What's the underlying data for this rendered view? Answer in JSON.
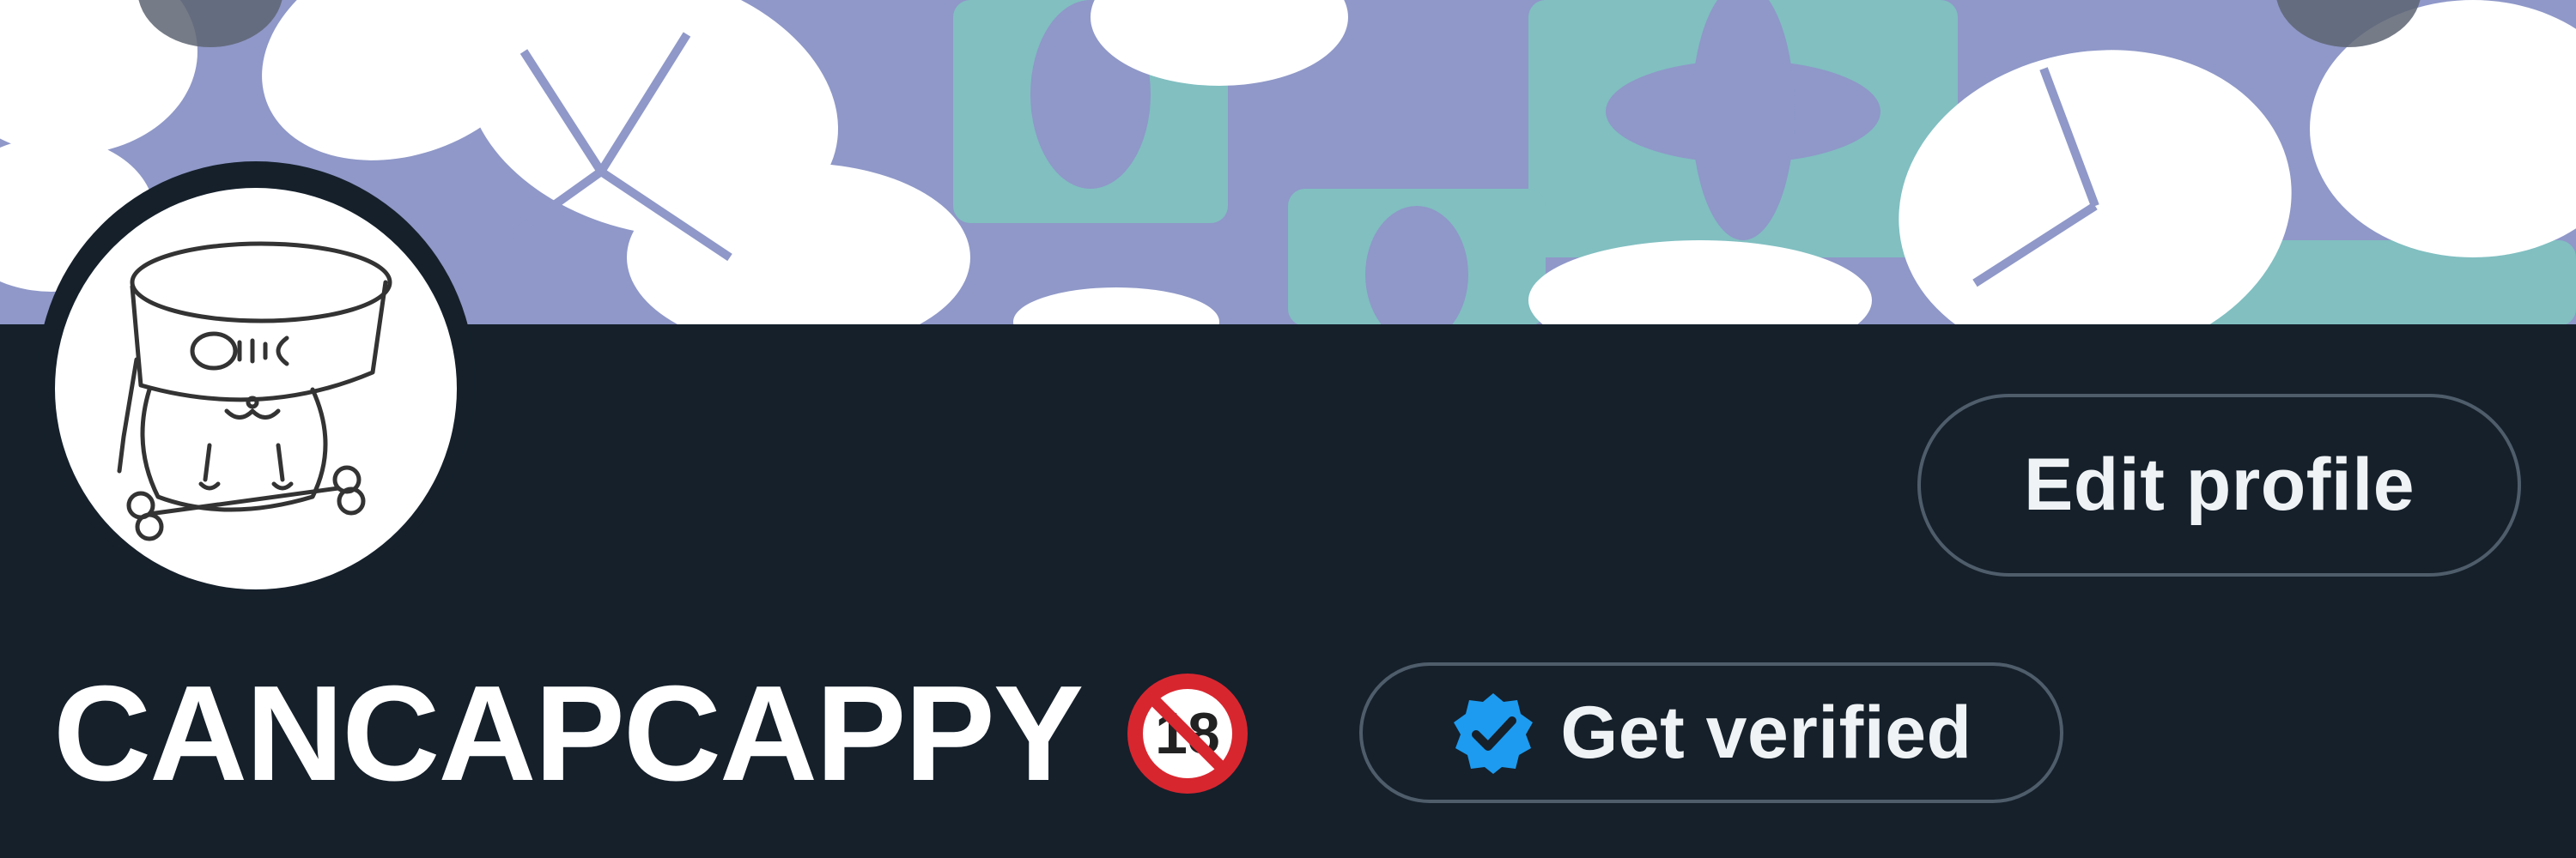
{
  "profile": {
    "display_name": "CANCAPCAPPY",
    "content_badge_icon": "no-under-18-icon",
    "edit_profile_label": "Edit profile",
    "get_verified_label": "Get verified",
    "verified_icon": "verified-badge-icon"
  },
  "colors": {
    "background": "#15202b",
    "banner_base": "#8f98c8",
    "banner_accent": "#7fc6c0",
    "button_border": "#4f5d6b",
    "verified_blue": "#1d9bf0",
    "badge_red": "#d8262f"
  }
}
